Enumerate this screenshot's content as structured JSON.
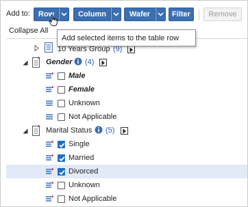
{
  "toolbar": {
    "add_to_label": "Add to:",
    "row_label": "Row",
    "column_label": "Column",
    "wafer_label": "Wafer",
    "filter_label": "Filter",
    "remove_label": "Remove",
    "accent_color": "#3c6fb0"
  },
  "collapse_text": "Collapse All",
  "tooltip": "Add selected items to the table row",
  "tree": {
    "ten_years_group": {
      "label": "10 Years Group",
      "count": "(9)"
    },
    "gender": {
      "label": "Gender",
      "count": "(4)",
      "items": [
        {
          "label": "Male",
          "checked": false,
          "style": "bold-italic"
        },
        {
          "label": "Female",
          "checked": false,
          "style": "bold-italic"
        },
        {
          "label": "Unknown",
          "checked": false,
          "style": "normal"
        },
        {
          "label": "Not Applicable",
          "checked": false,
          "style": "normal"
        }
      ]
    },
    "marital_status": {
      "label": "Marital Status",
      "count": "(5)",
      "items": [
        {
          "label": "Single",
          "checked": true
        },
        {
          "label": "Married",
          "checked": true
        },
        {
          "label": "Divorced",
          "checked": true,
          "highlighted": true
        },
        {
          "label": "Unknown",
          "checked": false
        },
        {
          "label": "Not Applicable",
          "checked": false
        }
      ]
    }
  }
}
